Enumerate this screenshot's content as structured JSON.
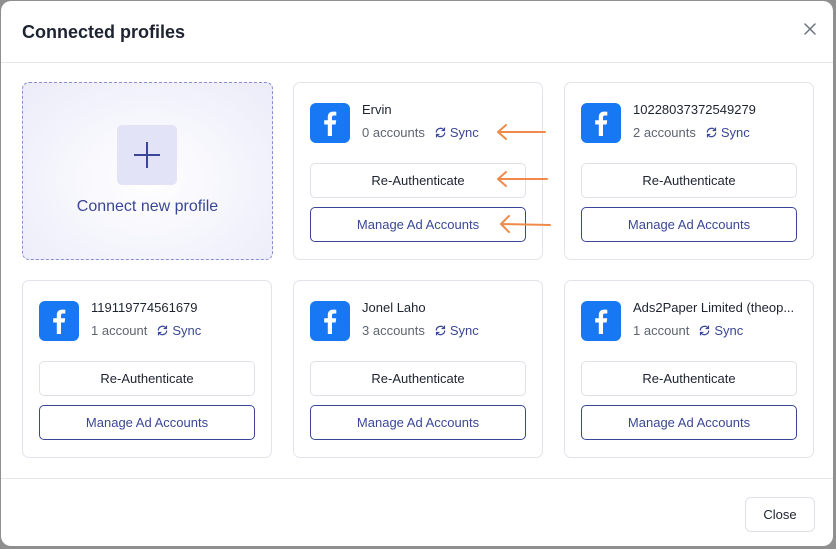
{
  "modal": {
    "title": "Connected profiles",
    "close_icon": "close-icon",
    "close_button_label": "Close"
  },
  "connect_card": {
    "label": "Connect new profile",
    "icon": "plus-icon"
  },
  "profiles": [
    {
      "name": "Ervin",
      "accounts": "0 accounts",
      "sync_label": "Sync",
      "reauth_label": "Re-Authenticate",
      "manage_label": "Manage Ad Accounts"
    },
    {
      "name": "10228037372549279",
      "accounts": "2 accounts",
      "sync_label": "Sync",
      "reauth_label": "Re-Authenticate",
      "manage_label": "Manage Ad Accounts"
    },
    {
      "name": "119119774561679",
      "accounts": "1 account",
      "sync_label": "Sync",
      "reauth_label": "Re-Authenticate",
      "manage_label": "Manage Ad Accounts"
    },
    {
      "name": "Jonel Laho",
      "accounts": "3 accounts",
      "sync_label": "Sync",
      "reauth_label": "Re-Authenticate",
      "manage_label": "Manage Ad Accounts"
    },
    {
      "name": "Ads2Paper Limited (theop...",
      "accounts": "1 account",
      "sync_label": "Sync",
      "reauth_label": "Re-Authenticate",
      "manage_label": "Manage Ad Accounts"
    }
  ],
  "colors": {
    "accent": "#3a4796",
    "facebook": "#1877f2",
    "annotation_arrow": "#f08a4b"
  }
}
